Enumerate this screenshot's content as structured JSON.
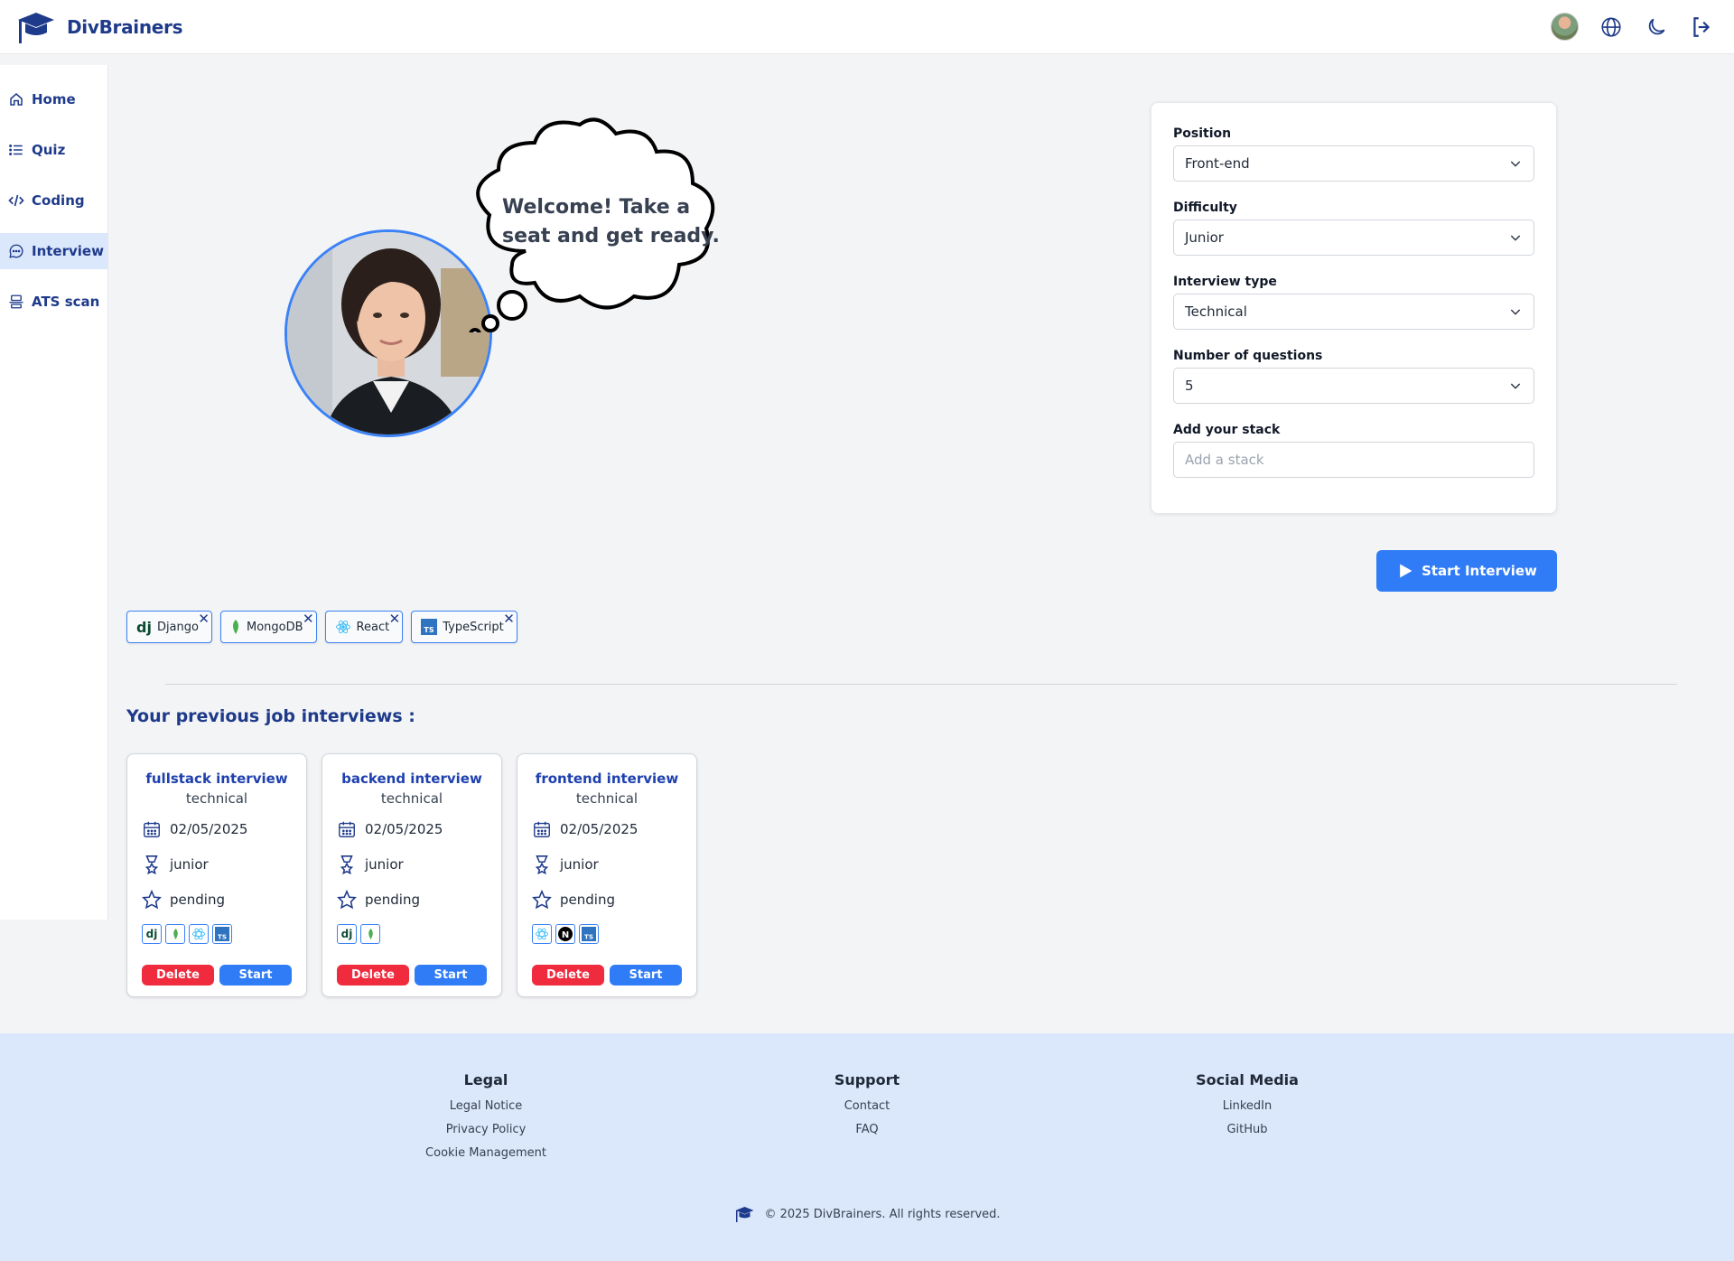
{
  "app": {
    "brand": "DivBrainers"
  },
  "sidebar": {
    "items": [
      {
        "label": "Home",
        "icon": "home-icon"
      },
      {
        "label": "Quiz",
        "icon": "list-icon"
      },
      {
        "label": "Coding",
        "icon": "code-icon"
      },
      {
        "label": "Interview",
        "icon": "chat-icon",
        "active": true
      },
      {
        "label": "ATS scan",
        "icon": "scan-icon"
      }
    ]
  },
  "hero": {
    "speech": "Welcome! Take a seat and get ready."
  },
  "form": {
    "position_label": "Position",
    "position_value": "Front-end",
    "difficulty_label": "Difficulty",
    "difficulty_value": "Junior",
    "type_label": "Interview type",
    "type_value": "Technical",
    "count_label": "Number of questions",
    "count_value": "5",
    "stack_label": "Add your stack",
    "stack_placeholder": "Add a stack",
    "start_label": "Start Interview"
  },
  "stack_tags": [
    "Django",
    "MongoDB",
    "React",
    "TypeScript"
  ],
  "previous": {
    "title": "Your previous job interviews :",
    "cards": [
      {
        "title": "fullstack interview",
        "type": "technical",
        "date": "02/05/2025",
        "level": "junior",
        "status": "pending"
      },
      {
        "title": "backend interview",
        "type": "technical",
        "date": "02/05/2025",
        "level": "junior",
        "status": "pending"
      },
      {
        "title": "frontend interview",
        "type": "technical",
        "date": "02/05/2025",
        "level": "junior",
        "status": "pending"
      }
    ],
    "delete_label": "Delete",
    "start_label": "Start"
  },
  "footer": {
    "legal": {
      "heading": "Legal",
      "links": [
        "Legal Notice",
        "Privacy Policy",
        "Cookie Management"
      ]
    },
    "support": {
      "heading": "Support",
      "links": [
        "Contact",
        "FAQ"
      ]
    },
    "social": {
      "heading": "Social Media",
      "links": [
        "LinkedIn",
        "GitHub"
      ]
    },
    "copyright": "© 2025 DivBrainers. All rights reserved."
  },
  "colors": {
    "primary": "#2f7cf6",
    "brand": "#1e3a8a",
    "danger": "#ef2b3d",
    "footer_bg": "#dbe7fb"
  }
}
